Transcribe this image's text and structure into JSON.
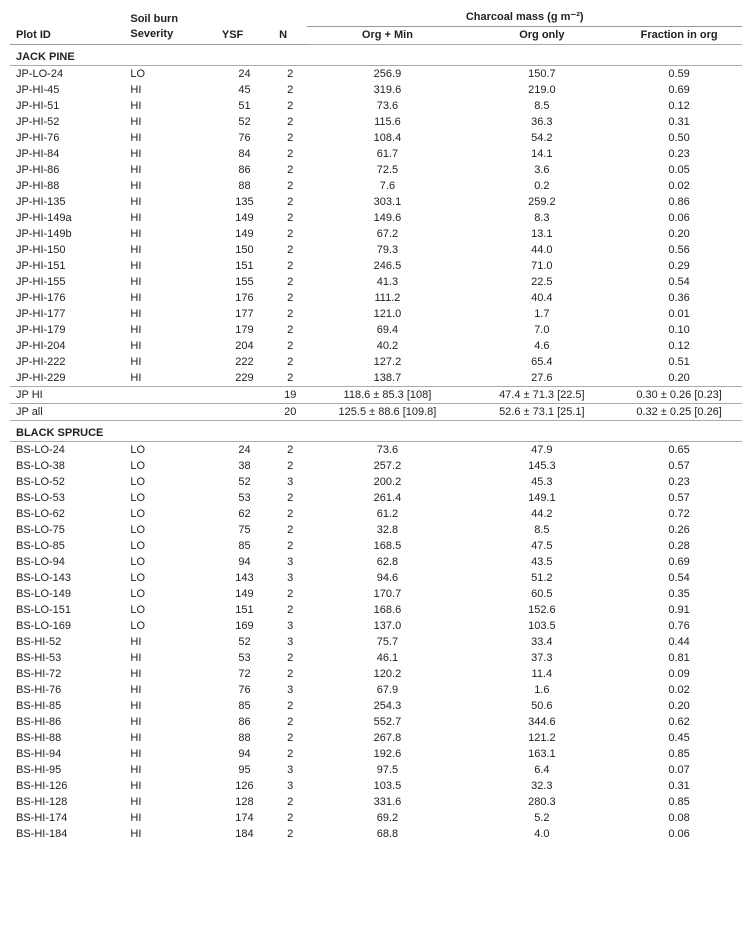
{
  "table": {
    "headers": {
      "plotid": "Plot ID",
      "severity": "Soil burn\nSeverity",
      "ysf": "YSF",
      "n": "N",
      "charcoal_group": "Charcoal mass (g m⁻²)",
      "orgmin": "Org + Min",
      "orgonly": "Org only",
      "fraction": "Fraction in org"
    },
    "sections": [
      {
        "name": "JACK PINE",
        "rows": [
          {
            "plotid": "JP-LO-24",
            "severity": "LO",
            "ysf": "24",
            "n": "2",
            "orgmin": "256.9",
            "orgonly": "150.7",
            "fraction": "0.59"
          },
          {
            "plotid": "JP-HI-45",
            "severity": "HI",
            "ysf": "45",
            "n": "2",
            "orgmin": "319.6",
            "orgonly": "219.0",
            "fraction": "0.69"
          },
          {
            "plotid": "JP-HI-51",
            "severity": "HI",
            "ysf": "51",
            "n": "2",
            "orgmin": "73.6",
            "orgonly": "8.5",
            "fraction": "0.12"
          },
          {
            "plotid": "JP-HI-52",
            "severity": "HI",
            "ysf": "52",
            "n": "2",
            "orgmin": "115.6",
            "orgonly": "36.3",
            "fraction": "0.31"
          },
          {
            "plotid": "JP-HI-76",
            "severity": "HI",
            "ysf": "76",
            "n": "2",
            "orgmin": "108.4",
            "orgonly": "54.2",
            "fraction": "0.50"
          },
          {
            "plotid": "JP-HI-84",
            "severity": "HI",
            "ysf": "84",
            "n": "2",
            "orgmin": "61.7",
            "orgonly": "14.1",
            "fraction": "0.23"
          },
          {
            "plotid": "JP-HI-86",
            "severity": "HI",
            "ysf": "86",
            "n": "2",
            "orgmin": "72.5",
            "orgonly": "3.6",
            "fraction": "0.05"
          },
          {
            "plotid": "JP-HI-88",
            "severity": "HI",
            "ysf": "88",
            "n": "2",
            "orgmin": "7.6",
            "orgonly": "0.2",
            "fraction": "0.02"
          },
          {
            "plotid": "JP-HI-135",
            "severity": "HI",
            "ysf": "135",
            "n": "2",
            "orgmin": "303.1",
            "orgonly": "259.2",
            "fraction": "0.86"
          },
          {
            "plotid": "JP-HI-149a",
            "severity": "HI",
            "ysf": "149",
            "n": "2",
            "orgmin": "149.6",
            "orgonly": "8.3",
            "fraction": "0.06"
          },
          {
            "plotid": "JP-HI-149b",
            "severity": "HI",
            "ysf": "149",
            "n": "2",
            "orgmin": "67.2",
            "orgonly": "13.1",
            "fraction": "0.20"
          },
          {
            "plotid": "JP-HI-150",
            "severity": "HI",
            "ysf": "150",
            "n": "2",
            "orgmin": "79.3",
            "orgonly": "44.0",
            "fraction": "0.56"
          },
          {
            "plotid": "JP-HI-151",
            "severity": "HI",
            "ysf": "151",
            "n": "2",
            "orgmin": "246.5",
            "orgonly": "71.0",
            "fraction": "0.29"
          },
          {
            "plotid": "JP-HI-155",
            "severity": "HI",
            "ysf": "155",
            "n": "2",
            "orgmin": "41.3",
            "orgonly": "22.5",
            "fraction": "0.54"
          },
          {
            "plotid": "JP-HI-176",
            "severity": "HI",
            "ysf": "176",
            "n": "2",
            "orgmin": "111.2",
            "orgonly": "40.4",
            "fraction": "0.36"
          },
          {
            "plotid": "JP-HI-177",
            "severity": "HI",
            "ysf": "177",
            "n": "2",
            "orgmin": "121.0",
            "orgonly": "1.7",
            "fraction": "0.01"
          },
          {
            "plotid": "JP-HI-179",
            "severity": "HI",
            "ysf": "179",
            "n": "2",
            "orgmin": "69.4",
            "orgonly": "7.0",
            "fraction": "0.10"
          },
          {
            "plotid": "JP-HI-204",
            "severity": "HI",
            "ysf": "204",
            "n": "2",
            "orgmin": "40.2",
            "orgonly": "4.6",
            "fraction": "0.12"
          },
          {
            "plotid": "JP-HI-222",
            "severity": "HI",
            "ysf": "222",
            "n": "2",
            "orgmin": "127.2",
            "orgonly": "65.4",
            "fraction": "0.51"
          },
          {
            "plotid": "JP-HI-229",
            "severity": "HI",
            "ysf": "229",
            "n": "2",
            "orgmin": "138.7",
            "orgonly": "27.6",
            "fraction": "0.20"
          }
        ],
        "summaries": [
          {
            "plotid": "JP HI",
            "severity": "",
            "ysf": "",
            "n": "19",
            "orgmin": "118.6 ± 85.3 [108]",
            "orgonly": "47.4 ± 71.3 [22.5]",
            "fraction": "0.30 ± 0.26 [0.23]"
          },
          {
            "plotid": "JP all",
            "severity": "",
            "ysf": "",
            "n": "20",
            "orgmin": "125.5 ± 88.6 [109.8]",
            "orgonly": "52.6 ± 73.1 [25.1]",
            "fraction": "0.32 ± 0.25 [0.26]"
          }
        ]
      },
      {
        "name": "BLACK SPRUCE",
        "rows": [
          {
            "plotid": "BS-LO-24",
            "severity": "LO",
            "ysf": "24",
            "n": "2",
            "orgmin": "73.6",
            "orgonly": "47.9",
            "fraction": "0.65"
          },
          {
            "plotid": "BS-LO-38",
            "severity": "LO",
            "ysf": "38",
            "n": "2",
            "orgmin": "257.2",
            "orgonly": "145.3",
            "fraction": "0.57"
          },
          {
            "plotid": "BS-LO-52",
            "severity": "LO",
            "ysf": "52",
            "n": "3",
            "orgmin": "200.2",
            "orgonly": "45.3",
            "fraction": "0.23"
          },
          {
            "plotid": "BS-LO-53",
            "severity": "LO",
            "ysf": "53",
            "n": "2",
            "orgmin": "261.4",
            "orgonly": "149.1",
            "fraction": "0.57"
          },
          {
            "plotid": "BS-LO-62",
            "severity": "LO",
            "ysf": "62",
            "n": "2",
            "orgmin": "61.2",
            "orgonly": "44.2",
            "fraction": "0.72"
          },
          {
            "plotid": "BS-LO-75",
            "severity": "LO",
            "ysf": "75",
            "n": "2",
            "orgmin": "32.8",
            "orgonly": "8.5",
            "fraction": "0.26"
          },
          {
            "plotid": "BS-LO-85",
            "severity": "LO",
            "ysf": "85",
            "n": "2",
            "orgmin": "168.5",
            "orgonly": "47.5",
            "fraction": "0.28"
          },
          {
            "plotid": "BS-LO-94",
            "severity": "LO",
            "ysf": "94",
            "n": "3",
            "orgmin": "62.8",
            "orgonly": "43.5",
            "fraction": "0.69"
          },
          {
            "plotid": "BS-LO-143",
            "severity": "LO",
            "ysf": "143",
            "n": "3",
            "orgmin": "94.6",
            "orgonly": "51.2",
            "fraction": "0.54"
          },
          {
            "plotid": "BS-LO-149",
            "severity": "LO",
            "ysf": "149",
            "n": "2",
            "orgmin": "170.7",
            "orgonly": "60.5",
            "fraction": "0.35"
          },
          {
            "plotid": "BS-LO-151",
            "severity": "LO",
            "ysf": "151",
            "n": "2",
            "orgmin": "168.6",
            "orgonly": "152.6",
            "fraction": "0.91"
          },
          {
            "plotid": "BS-LO-169",
            "severity": "LO",
            "ysf": "169",
            "n": "3",
            "orgmin": "137.0",
            "orgonly": "103.5",
            "fraction": "0.76"
          },
          {
            "plotid": "BS-HI-52",
            "severity": "HI",
            "ysf": "52",
            "n": "3",
            "orgmin": "75.7",
            "orgonly": "33.4",
            "fraction": "0.44"
          },
          {
            "plotid": "BS-HI-53",
            "severity": "HI",
            "ysf": "53",
            "n": "2",
            "orgmin": "46.1",
            "orgonly": "37.3",
            "fraction": "0.81"
          },
          {
            "plotid": "BS-HI-72",
            "severity": "HI",
            "ysf": "72",
            "n": "2",
            "orgmin": "120.2",
            "orgonly": "11.4",
            "fraction": "0.09"
          },
          {
            "plotid": "BS-HI-76",
            "severity": "HI",
            "ysf": "76",
            "n": "3",
            "orgmin": "67.9",
            "orgonly": "1.6",
            "fraction": "0.02"
          },
          {
            "plotid": "BS-HI-85",
            "severity": "HI",
            "ysf": "85",
            "n": "2",
            "orgmin": "254.3",
            "orgonly": "50.6",
            "fraction": "0.20"
          },
          {
            "plotid": "BS-HI-86",
            "severity": "HI",
            "ysf": "86",
            "n": "2",
            "orgmin": "552.7",
            "orgonly": "344.6",
            "fraction": "0.62"
          },
          {
            "plotid": "BS-HI-88",
            "severity": "HI",
            "ysf": "88",
            "n": "2",
            "orgmin": "267.8",
            "orgonly": "121.2",
            "fraction": "0.45"
          },
          {
            "plotid": "BS-HI-94",
            "severity": "HI",
            "ysf": "94",
            "n": "2",
            "orgmin": "192.6",
            "orgonly": "163.1",
            "fraction": "0.85"
          },
          {
            "plotid": "BS-HI-95",
            "severity": "HI",
            "ysf": "95",
            "n": "3",
            "orgmin": "97.5",
            "orgonly": "6.4",
            "fraction": "0.07"
          },
          {
            "plotid": "BS-HI-126",
            "severity": "HI",
            "ysf": "126",
            "n": "3",
            "orgmin": "103.5",
            "orgonly": "32.3",
            "fraction": "0.31"
          },
          {
            "plotid": "BS-HI-128",
            "severity": "HI",
            "ysf": "128",
            "n": "2",
            "orgmin": "331.6",
            "orgonly": "280.3",
            "fraction": "0.85"
          },
          {
            "plotid": "BS-HI-174",
            "severity": "HI",
            "ysf": "174",
            "n": "2",
            "orgmin": "69.2",
            "orgonly": "5.2",
            "fraction": "0.08"
          },
          {
            "plotid": "BS-HI-184",
            "severity": "HI",
            "ysf": "184",
            "n": "2",
            "orgmin": "68.8",
            "orgonly": "4.0",
            "fraction": "0.06"
          }
        ],
        "summaries": []
      }
    ]
  }
}
